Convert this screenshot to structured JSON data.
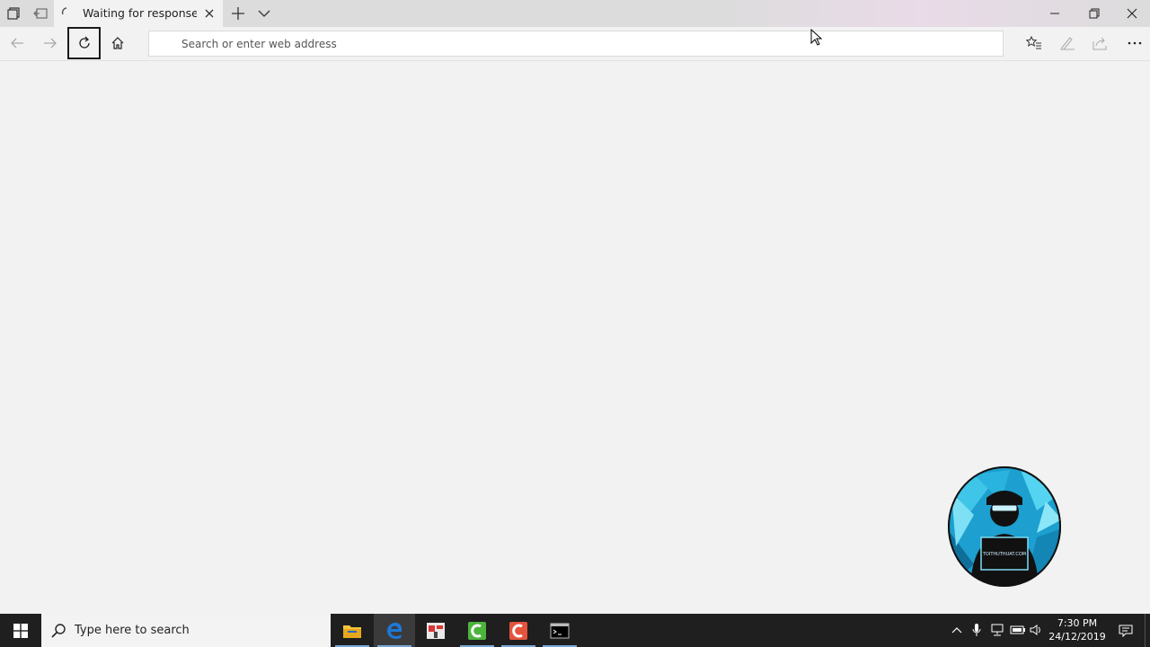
{
  "browser": {
    "tab": {
      "title": "Waiting for response fro"
    },
    "address_bar": {
      "placeholder": "Search or enter web address",
      "value": ""
    }
  },
  "taskbar": {
    "search_placeholder": "Type here to search",
    "clock": {
      "time": "7:30 PM",
      "date": "24/12/2019"
    },
    "apps": [
      "file-explorer",
      "edge",
      "app-red-white",
      "app-green",
      "app-red",
      "command-prompt"
    ]
  },
  "colors": {
    "tab_bar_bg": "#dcdcdc",
    "page_bg": "#f2f2f2",
    "taskbar_bg": "#1f1f1f",
    "edge_blue": "#1e78d7"
  },
  "logo": {
    "text": "TOITHUTHUAT.COM"
  }
}
